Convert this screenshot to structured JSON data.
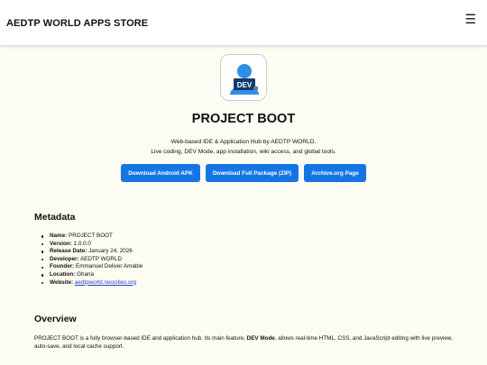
{
  "header": {
    "brand": "AEDTP WORLD APPS STORE",
    "menu_glyph": "☰"
  },
  "app": {
    "logo_badge": "DEV",
    "title": "PROJECT BOOT",
    "subtitle_1": "Web-based IDE & Application Hub by AEDTP WORLD.",
    "subtitle_2": "Live coding, DEV Mode, app installation, wiki access, and global tools."
  },
  "buttons": [
    {
      "label": "Download Android APK"
    },
    {
      "label": "Download Full Package (ZIP)"
    },
    {
      "label": "Archive.org Page"
    }
  ],
  "metadata": {
    "heading": "Metadata",
    "items": [
      {
        "key": "Name:",
        "value": "PROJECT BOOT"
      },
      {
        "key": "Version:",
        "value": "1.0.0.0"
      },
      {
        "key": "Release Date:",
        "value": "January 24, 2026"
      },
      {
        "key": "Developer:",
        "value": "AEDTP WORLD"
      },
      {
        "key": "Founder:",
        "value": "Emmanuel Deliver Amable"
      },
      {
        "key": "Location:",
        "value": "Ghana"
      },
      {
        "key": "Website:",
        "value": "aedtpworld.neocities.org"
      }
    ]
  },
  "overview": {
    "heading": "Overview",
    "text_before": "PROJECT BOOT is a fully browser-based IDE and application hub. Its main feature,",
    "highlight": "DEV Mode",
    "text_after": ", allows real-time HTML, CSS, and JavaScript editing with live preview, auto-save, and local cache support."
  },
  "colors": {
    "background": "#fdfcf2",
    "button": "#1476e6",
    "link": "#1a47d6",
    "logo_circle": "#2f8fe6"
  }
}
